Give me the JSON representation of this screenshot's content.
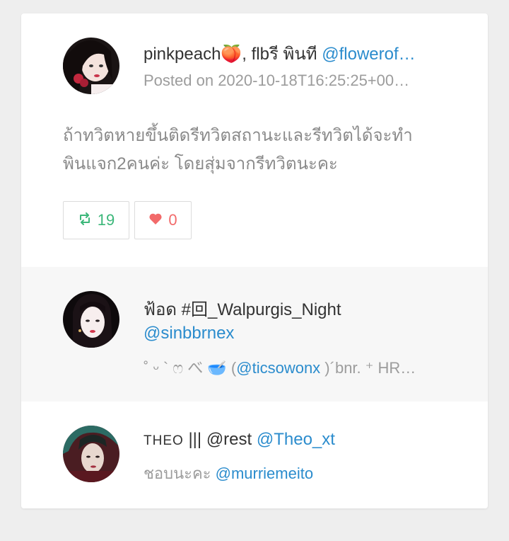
{
  "tweet": {
    "author_name": "pinkpeach🍑, flbรี พินที",
    "author_handle": "@flowerof…",
    "posted": "Posted on 2020-10-18T16:25:25+00…",
    "text_line1": "ถ้าทวิตหายขึ้นติดรีทวิตสถานะและรีทวิตได้จะทำ",
    "text_line2": "พินแจก2คนค่ะ โดยสุ่มจากรีทวิตนะคะ",
    "retweets": "19",
    "likes": "0",
    "retweet_icon": "retweet-icon",
    "like_icon": "heart-icon"
  },
  "users": [
    {
      "name": "ฟ้อด #回_Walpurgis_Night",
      "handle": "@sinbbrnex",
      "bio_prefix": "˚ ᵕ ` ෆ べ 🥣 (",
      "bio_link": "@ticsowonx",
      "bio_suffix": " )´bnr. ⁺ HR…"
    },
    {
      "name_caps": "THEO",
      "name_rest": " ||| @rest ",
      "handle": "@Theo_xt",
      "bio_prefix": "ชอบนะคะ ",
      "bio_link": "@murriemeito"
    }
  ],
  "colors": {
    "link": "#2b8ccd",
    "retweet": "#3cb77a",
    "like": "#f26a6a",
    "muted": "#9c9c9c"
  }
}
